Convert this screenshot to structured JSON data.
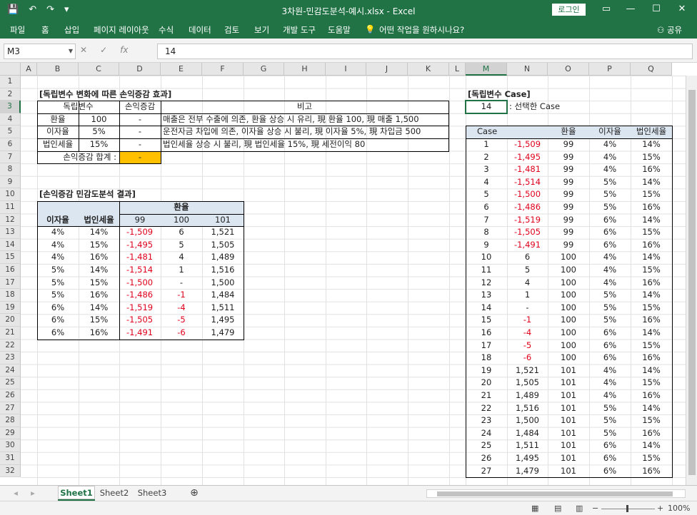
{
  "window": {
    "title": "3차원-민감도분석-예시.xlsx  -  Excel",
    "login": "로그인",
    "share": "공유"
  },
  "qat": [
    "💾",
    "↶",
    "↷",
    "▾"
  ],
  "ribbon_tabs": [
    "파일",
    "홈",
    "삽입",
    "페이지 레이아웃",
    "수식",
    "데이터",
    "검토",
    "보기",
    "개발 도구",
    "도움말",
    "어떤 작업을 원하시나요?"
  ],
  "formula_bar": {
    "name_box": "M3",
    "formula": "14"
  },
  "columns": [
    "A",
    "B",
    "C",
    "D",
    "E",
    "F",
    "G",
    "H",
    "I",
    "J",
    "K",
    "L",
    "M",
    "N",
    "O",
    "P",
    "Q"
  ],
  "rows": [
    "1",
    "2",
    "3",
    "4",
    "5",
    "6",
    "7",
    "8",
    "9",
    "10",
    "11",
    "12",
    "13",
    "14",
    "15",
    "16",
    "17",
    "18",
    "19",
    "20",
    "21",
    "22",
    "23",
    "24",
    "25",
    "26",
    "27",
    "28",
    "29",
    "30",
    "31",
    "32"
  ],
  "effect_table": {
    "title": "[독립변수 변화에 따른 손익증감 효과]",
    "headers": [
      "독립변수",
      "손익증감",
      "비고"
    ],
    "rows": [
      [
        "환율",
        "100",
        "-",
        "매출은 전부 수출에 의존, 환율 상승 시 유리, 現 환율 100, 現 매출 1,500"
      ],
      [
        "이자율",
        "5%",
        "-",
        "운전자금 차입에 의존, 이자율 상승 시 불리, 現 이자율 5%, 現 차입금 500"
      ],
      [
        "법인세율",
        "15%",
        "-",
        "법인세율 상승 시 불리, 現 법인세율 15%, 現 세전이익 80"
      ]
    ],
    "total_label": "손익증감 합계 :",
    "total_value": "-"
  },
  "sensitivity": {
    "title": "[손익증감 민감도분석 결과]",
    "col_group": "환율",
    "h_rate": "이자율",
    "h_tax": "법인세율",
    "fx_values": [
      "99",
      "100",
      "101"
    ],
    "rows": [
      [
        "4%",
        "14%",
        "-1,509",
        "6",
        "1,521"
      ],
      [
        "4%",
        "15%",
        "-1,495",
        "5",
        "1,505"
      ],
      [
        "4%",
        "16%",
        "-1,481",
        "4",
        "1,489"
      ],
      [
        "5%",
        "14%",
        "-1,514",
        "1",
        "1,516"
      ],
      [
        "5%",
        "15%",
        "-1,500",
        "-",
        "1,500"
      ],
      [
        "5%",
        "16%",
        "-1,486",
        "-1",
        "1,484"
      ],
      [
        "6%",
        "14%",
        "-1,519",
        "-4",
        "1,511"
      ],
      [
        "6%",
        "15%",
        "-1,505",
        "-5",
        "1,495"
      ],
      [
        "6%",
        "16%",
        "-1,491",
        "-6",
        "1,479"
      ]
    ]
  },
  "case_table": {
    "title": "[독립변수 Case]",
    "selected_value": "14",
    "selected_note": ": 선택한 Case",
    "headers": [
      "Case",
      "",
      "환율",
      "이자율",
      "법인세율"
    ],
    "rows": [
      [
        "1",
        "-1,509",
        "99",
        "4%",
        "14%"
      ],
      [
        "2",
        "-1,495",
        "99",
        "4%",
        "15%"
      ],
      [
        "3",
        "-1,481",
        "99",
        "4%",
        "16%"
      ],
      [
        "4",
        "-1,514",
        "99",
        "5%",
        "14%"
      ],
      [
        "5",
        "-1,500",
        "99",
        "5%",
        "15%"
      ],
      [
        "6",
        "-1,486",
        "99",
        "5%",
        "16%"
      ],
      [
        "7",
        "-1,519",
        "99",
        "6%",
        "14%"
      ],
      [
        "8",
        "-1,505",
        "99",
        "6%",
        "15%"
      ],
      [
        "9",
        "-1,491",
        "99",
        "6%",
        "16%"
      ],
      [
        "10",
        "6",
        "100",
        "4%",
        "14%"
      ],
      [
        "11",
        "5",
        "100",
        "4%",
        "15%"
      ],
      [
        "12",
        "4",
        "100",
        "4%",
        "16%"
      ],
      [
        "13",
        "1",
        "100",
        "5%",
        "14%"
      ],
      [
        "14",
        "-",
        "100",
        "5%",
        "15%"
      ],
      [
        "15",
        "-1",
        "100",
        "5%",
        "16%"
      ],
      [
        "16",
        "-4",
        "100",
        "6%",
        "14%"
      ],
      [
        "17",
        "-5",
        "100",
        "6%",
        "15%"
      ],
      [
        "18",
        "-6",
        "100",
        "6%",
        "16%"
      ],
      [
        "19",
        "1,521",
        "101",
        "4%",
        "14%"
      ],
      [
        "20",
        "1,505",
        "101",
        "4%",
        "15%"
      ],
      [
        "21",
        "1,489",
        "101",
        "4%",
        "16%"
      ],
      [
        "22",
        "1,516",
        "101",
        "5%",
        "14%"
      ],
      [
        "23",
        "1,500",
        "101",
        "5%",
        "15%"
      ],
      [
        "24",
        "1,484",
        "101",
        "5%",
        "16%"
      ],
      [
        "25",
        "1,511",
        "101",
        "6%",
        "14%"
      ],
      [
        "26",
        "1,495",
        "101",
        "6%",
        "15%"
      ],
      [
        "27",
        "1,479",
        "101",
        "6%",
        "16%"
      ]
    ]
  },
  "sheets": [
    "Sheet1",
    "Sheet2",
    "Sheet3"
  ],
  "status": {
    "zoom": "100%"
  },
  "colors": {
    "excel_green": "#217346",
    "negative": "#e0001b",
    "highlight": "#ffc000",
    "header_fill": "#dce6f1"
  }
}
